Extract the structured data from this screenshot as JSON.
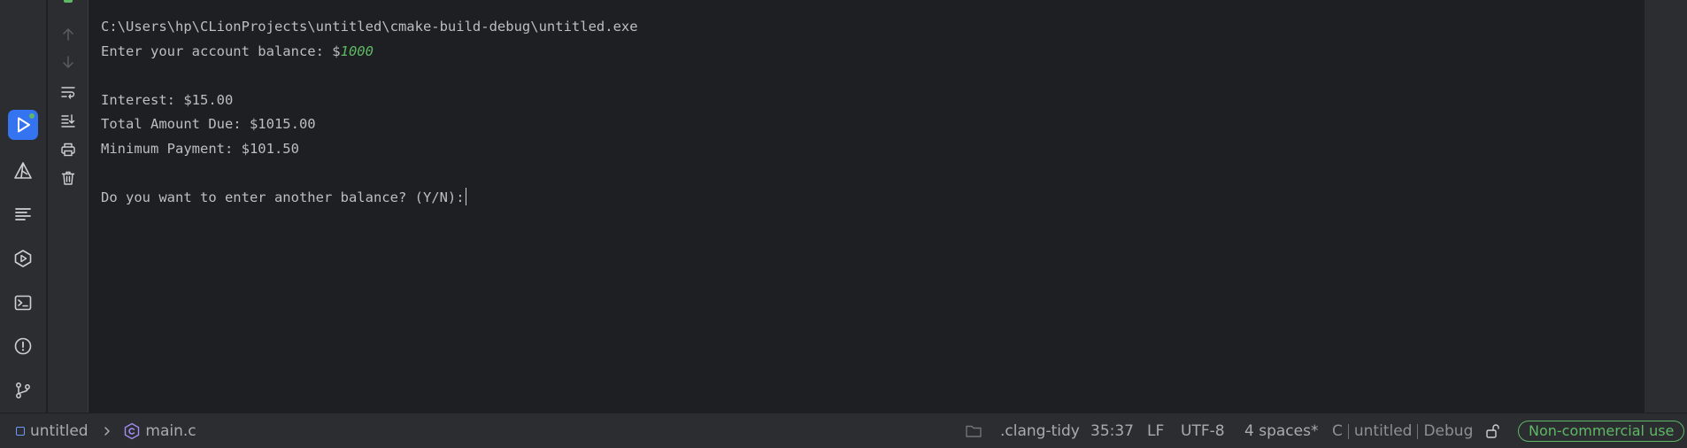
{
  "console": {
    "lines": [
      "C:\\Users\\hp\\CLionProjects\\untitled\\cmake-build-debug\\untitled.exe",
      "Enter your account balance: $",
      "",
      "Interest: $15.00",
      "Total Amount Due: $1015.00",
      "Minimum Payment: $101.50",
      "",
      "Do you want to enter another balance? (Y/N):"
    ],
    "user_input": "1000"
  },
  "status_bar": {
    "project": "untitled",
    "file": "main.c",
    "clang_tidy": ".clang-tidy",
    "cursor_position": "35:37",
    "line_ending": "LF",
    "encoding": "UTF-8",
    "indent": "4 spaces*",
    "context_lang": "C",
    "context_project": "untitled",
    "context_config": "Debug",
    "license_badge": "Non-commercial use"
  },
  "colors": {
    "accent": "#3574f0",
    "success": "#5fb865",
    "danger": "#db5c5c",
    "background": "#1e1f22",
    "panel": "#2b2d30"
  }
}
